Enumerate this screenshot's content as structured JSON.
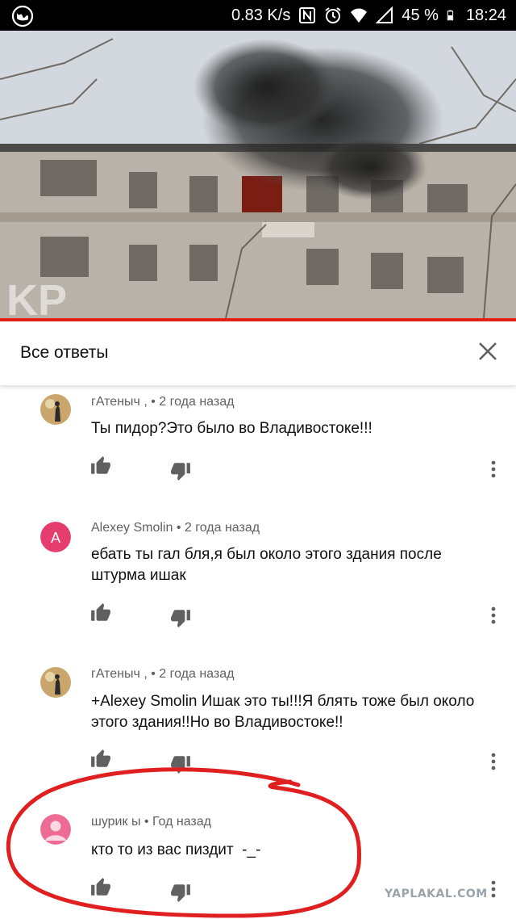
{
  "status_bar": {
    "speed": "0.83 K/s",
    "battery": "45 %",
    "time": "18:24",
    "icons": [
      "app-logo-icon",
      "nfc-icon",
      "alarm-icon",
      "wifi-icon",
      "signal-icon",
      "battery-icon"
    ]
  },
  "video": {
    "description_icon": "video-thumbnail",
    "progress": 1.0,
    "progress_color": "#e62117"
  },
  "header": {
    "title": "Все ответы",
    "close_icon": "close-icon"
  },
  "comments": [
    {
      "author": "гАтеныч ,",
      "time": "2 года назад",
      "text": "Ты пидор?Это было во Владивостоке!!!",
      "avatar_type": "photo"
    },
    {
      "author": "Alexey Smolin",
      "time": "2 года назад",
      "text": "ебать ты гал бля,я был около этого здания после штурма ишак",
      "avatar_type": "letter",
      "avatar_letter": "A",
      "avatar_color": "#e63d6f"
    },
    {
      "author": "гАтеныч ,",
      "time": "2 года назад",
      "text": "+Alexey Smolin Ишак это ты!!!Я блять тоже был около этого здания!!Но во Владивостоке!!",
      "avatar_type": "photo"
    },
    {
      "author": "шурик ы",
      "time": "Год назад",
      "text": "кто то из вас пиздит  -_-",
      "avatar_type": "default",
      "avatar_color": "#ee6b93"
    }
  ],
  "separator": "•",
  "watermark": "YAPLAKAL.COM",
  "highlight_color": "#e02020"
}
